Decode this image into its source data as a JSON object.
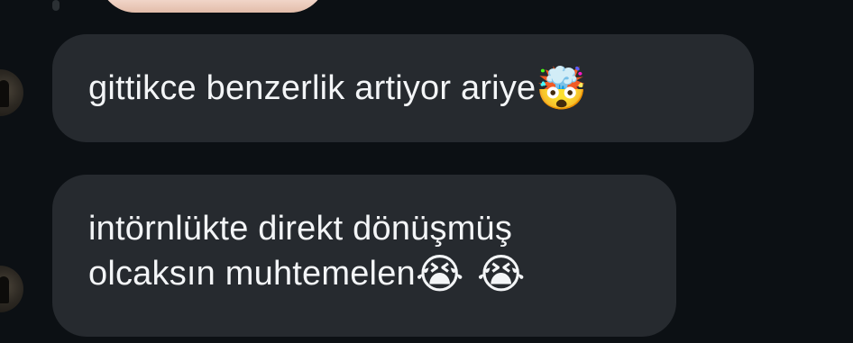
{
  "conversation": {
    "messages": [
      {
        "text": "gittikce benzerlik artiyor ariye",
        "emoji": "🤯"
      },
      {
        "lines": [
          "intörnlükte direkt dönüşmüş",
          "olcaksın muhtemelen"
        ],
        "emoji_1": "😭",
        "emoji_2": "😭"
      }
    ]
  },
  "icons": [
    "exploding-head-emoji-icon",
    "loudly-crying-face-emoji-icon"
  ],
  "colors": {
    "background": "#0c1014",
    "bubble": "#262a2f",
    "text": "#f3f5f7"
  }
}
